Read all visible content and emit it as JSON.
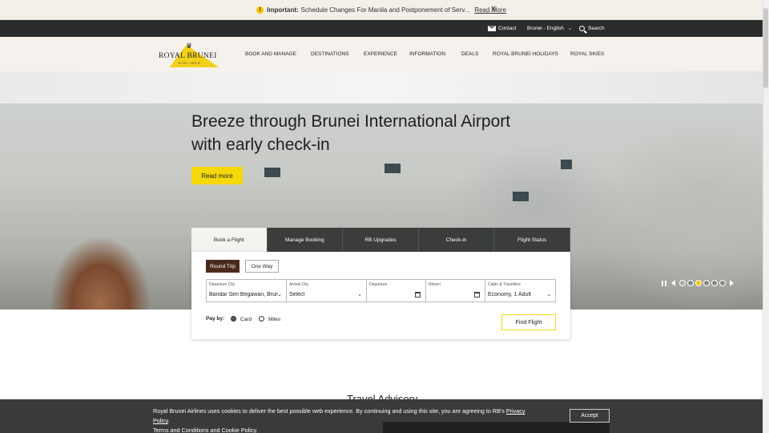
{
  "notice": {
    "icon": "warning-icon",
    "label": "Important:",
    "text": "Schedule Changes For Manila and Postponement of Serv...",
    "link": "Read More",
    "close": "X"
  },
  "topbar": {
    "contact": "Contact",
    "language": "Brunei - English",
    "search": "Search"
  },
  "header": {
    "logo_name": "ROYAL BRUNEI",
    "logo_sub": "AIRLINES",
    "nav": [
      {
        "label": "BOOK AND MANAGE"
      },
      {
        "label": "DESTINATIONS"
      },
      {
        "label": "EXPERIENCE"
      },
      {
        "label": "INFORMATION"
      },
      {
        "label": "DEALS"
      },
      {
        "label": "ROYAL BRUNEI HOLIDAYS"
      },
      {
        "label": "ROYAL SKIES"
      }
    ]
  },
  "hero": {
    "title": "Breeze through Brunei International Airport with early check-in",
    "button": "Read more",
    "slide_count": 6,
    "active_slide": 3
  },
  "booking": {
    "tabs": [
      {
        "label": "Book a Flight",
        "active": true
      },
      {
        "label": "Manage Booking"
      },
      {
        "label": "RB Upgrades"
      },
      {
        "label": "Check-in"
      },
      {
        "label": "Flight Status"
      }
    ],
    "trip_types": [
      "Round Trip",
      "One Way"
    ],
    "fields": {
      "departure_city": {
        "label": "Departure City",
        "value": "Bandar Seri Begawan, Brune..."
      },
      "arrival_city": {
        "label": "Arrival City",
        "value": "Select"
      },
      "departure": {
        "label": "Departure",
        "value": ""
      },
      "return": {
        "label": "Return",
        "value": ""
      },
      "cabin": {
        "label": "Cabin & Travellers",
        "value": "Economy, 1 Adult"
      }
    },
    "pay_by": "Pay by:",
    "pay_options": [
      "Card",
      "Miles"
    ],
    "find": "Find Flight"
  },
  "advisory_heading": "Travel Advisory",
  "cookie": {
    "text": "Royal Brunei Airlines uses cookies to deliver the best possible web experience. By continuing and using this site, you are agreeing to RB's",
    "privacy": "Privacy Policy",
    "period": ".",
    "terms": "Terms and Conditions",
    "and": "and",
    "cookie_policy": "Cookie Policy",
    "end": ".",
    "accept": "Accept"
  },
  "colors": {
    "accent_yellow": "#f5d90a",
    "dark_bar": "#2b2d2c",
    "active_trip": "#4a2a1c"
  }
}
